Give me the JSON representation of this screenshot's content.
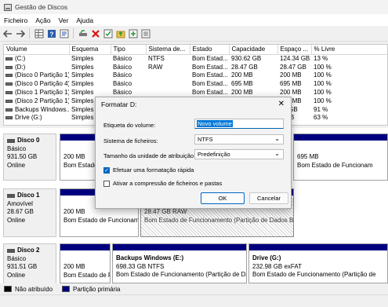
{
  "window": {
    "title": "Gestão de Discos"
  },
  "menu": [
    "Ficheiro",
    "Ação",
    "Ver",
    "Ajuda"
  ],
  "toolbar": {
    "icons": [
      "back-icon",
      "forward-icon",
      "grid-icon",
      "help-icon",
      "properties-icon",
      "connect-icon",
      "delete-icon",
      "check-icon",
      "folder-up-icon",
      "new-icon",
      "list-icon"
    ]
  },
  "volume_table": {
    "headers": [
      "Volume",
      "Esquema",
      "Tipo",
      "Sistema de...",
      "Estado",
      "Capacidade",
      "Espaço ...",
      "% Livre"
    ],
    "rows": [
      [
        "(C:)",
        "Simples",
        "Básico",
        "NTFS",
        "Bom Estad...",
        "930.62 GB",
        "124.34 GB",
        "13 %"
      ],
      [
        "(D:)",
        "Simples",
        "Básico",
        "RAW",
        "Bom Estad...",
        "28.47 GB",
        "28.47 GB",
        "100 %"
      ],
      [
        "(Disco 0 Partição 1)",
        "Simples",
        "Básico",
        "",
        "Bom Estad...",
        "200 MB",
        "200 MB",
        "100 %"
      ],
      [
        "(Disco 0 Partição 4)",
        "Simples",
        "Básico",
        "",
        "Bom Estad...",
        "695 MB",
        "695 MB",
        "100 %"
      ],
      [
        "(Disco 1 Partição 1)",
        "Simples",
        "Básico",
        "",
        "Bom Estad...",
        "200 MB",
        "200 MB",
        "100 %"
      ],
      [
        "(Disco 2 Partição 1)",
        "Simples",
        "Básico",
        "",
        "Bom Estad...",
        "200 MB",
        "200 MB",
        "100 %"
      ],
      [
        "Backups Windows...",
        "Simples",
        "Básico",
        "",
        "",
        "",
        "73 GB",
        "91 %"
      ],
      [
        "Drive (G:)",
        "Simples",
        "Básico",
        "",
        "",
        "",
        "7 GB",
        "63 %"
      ]
    ]
  },
  "disks": [
    {
      "name": "Disco 0",
      "type": "Básico",
      "size": "931.50 GB",
      "status": "Online",
      "partitions": [
        {
          "title": "",
          "size": "200 MB",
          "status": "Bom Estado de Funcioname"
        },
        {
          "title": "",
          "size": "695 MB",
          "status": "Bom Estado de Funcionam"
        }
      ]
    },
    {
      "name": "Disco 1",
      "type": "Amovível",
      "size": "28.67 GB",
      "status": "Online",
      "partitions": [
        {
          "title": "",
          "size": "200 MB",
          "status": "Bom Estado de Funcionam"
        },
        {
          "title": "",
          "size": "28.47 GB RAW",
          "status": "Bom Estado de Funcionamento (Partição de Dados B"
        }
      ]
    },
    {
      "name": "Disco 2",
      "type": "Básico",
      "size": "931.51 GB",
      "status": "Online",
      "partitions": [
        {
          "title": "",
          "size": "200 MB",
          "status": "Bom Estado de Fi"
        },
        {
          "title": "Backups Windows  (E:)",
          "size": "698.33 GB NTFS",
          "status": "Bom Estado de Funcionamento (Partição de Da"
        },
        {
          "title": "Drive  (G:)",
          "size": "232.98 GB exFAT",
          "status": "Bom Estado de Funcionamento (Partição de"
        }
      ]
    }
  ],
  "legend": {
    "unallocated": "Não atribuído",
    "primary": "Partição primária"
  },
  "dialog": {
    "title": "Formatar D:",
    "volume_label_caption": "Etiqueta do volume:",
    "volume_label_value": "Novo volume",
    "fs_caption": "Sistema de ficheiros:",
    "fs_value": "NTFS",
    "unit_caption": "Tamanho da unidade de atribuição:",
    "unit_value": "Predefinição",
    "quick_format": "Efetuar uma formatação rápida",
    "quick_format_checked": true,
    "compression": "Ativar a compressão de ficheiros e pastas",
    "compression_checked": false,
    "ok": "OK",
    "cancel": "Cancelar"
  }
}
